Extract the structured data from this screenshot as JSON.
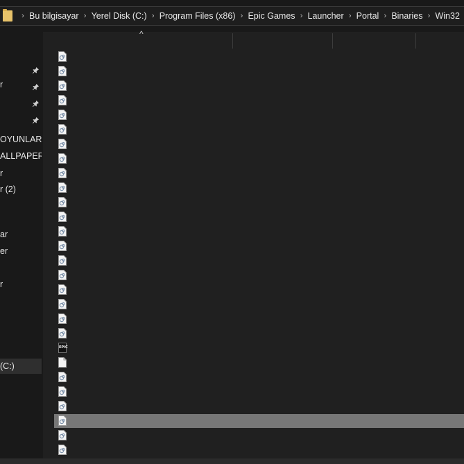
{
  "breadcrumb": {
    "items": [
      "Bu bilgisayar",
      "Yerel Disk (C:)",
      "Program Files (x86)",
      "Epic Games",
      "Launcher",
      "Portal",
      "Binaries",
      "Win32"
    ],
    "separator": "›"
  },
  "sidebar": {
    "items": [
      {
        "label": "",
        "pinned": true
      },
      {
        "label": "r",
        "pinned": true
      },
      {
        "label": "",
        "pinned": true
      },
      {
        "label": "",
        "pinned": true
      },
      {
        "label": "OYUNLAR",
        "pinned": false
      },
      {
        "label": "ALLPAPER",
        "pinned": false
      },
      {
        "label": "r",
        "pinned": false
      },
      {
        "label": "r (2)",
        "pinned": false
      },
      {
        "label": "",
        "pinned": false
      },
      {
        "label": "ar",
        "pinned": false
      },
      {
        "label": "er",
        "pinned": false
      },
      {
        "label": "",
        "pinned": false
      },
      {
        "label": "r",
        "pinned": false
      },
      {
        "label": "(C:)",
        "pinned": false,
        "selected": true
      }
    ]
  },
  "file_list": {
    "sort_indicator": "^",
    "rows": [
      {
        "icon": "dll-file-icon"
      },
      {
        "icon": "dll-file-icon"
      },
      {
        "icon": "dll-file-icon"
      },
      {
        "icon": "dll-file-icon"
      },
      {
        "icon": "dll-file-icon"
      },
      {
        "icon": "dll-file-icon"
      },
      {
        "icon": "dll-file-icon"
      },
      {
        "icon": "dll-file-icon"
      },
      {
        "icon": "dll-file-icon"
      },
      {
        "icon": "dll-file-icon"
      },
      {
        "icon": "dll-file-icon"
      },
      {
        "icon": "dll-file-icon"
      },
      {
        "icon": "dll-file-icon"
      },
      {
        "icon": "dll-file-icon"
      },
      {
        "icon": "dll-file-icon"
      },
      {
        "icon": "dll-file-icon"
      },
      {
        "icon": "dll-file-icon"
      },
      {
        "icon": "dll-file-icon"
      },
      {
        "icon": "dll-file-icon"
      },
      {
        "icon": "dll-file-icon"
      },
      {
        "icon": "epic-games-icon",
        "badge": "EPIC"
      },
      {
        "icon": "blank-file-icon"
      },
      {
        "icon": "dll-file-icon"
      },
      {
        "icon": "dll-file-icon"
      },
      {
        "icon": "dll-file-icon"
      },
      {
        "icon": "dll-file-icon",
        "selected": true
      },
      {
        "icon": "dll-file-icon"
      },
      {
        "icon": "dll-file-icon"
      }
    ]
  },
  "colors": {
    "background": "#191919",
    "list_background": "#202020",
    "selection": "#777777",
    "folder": "#e8c36a"
  }
}
